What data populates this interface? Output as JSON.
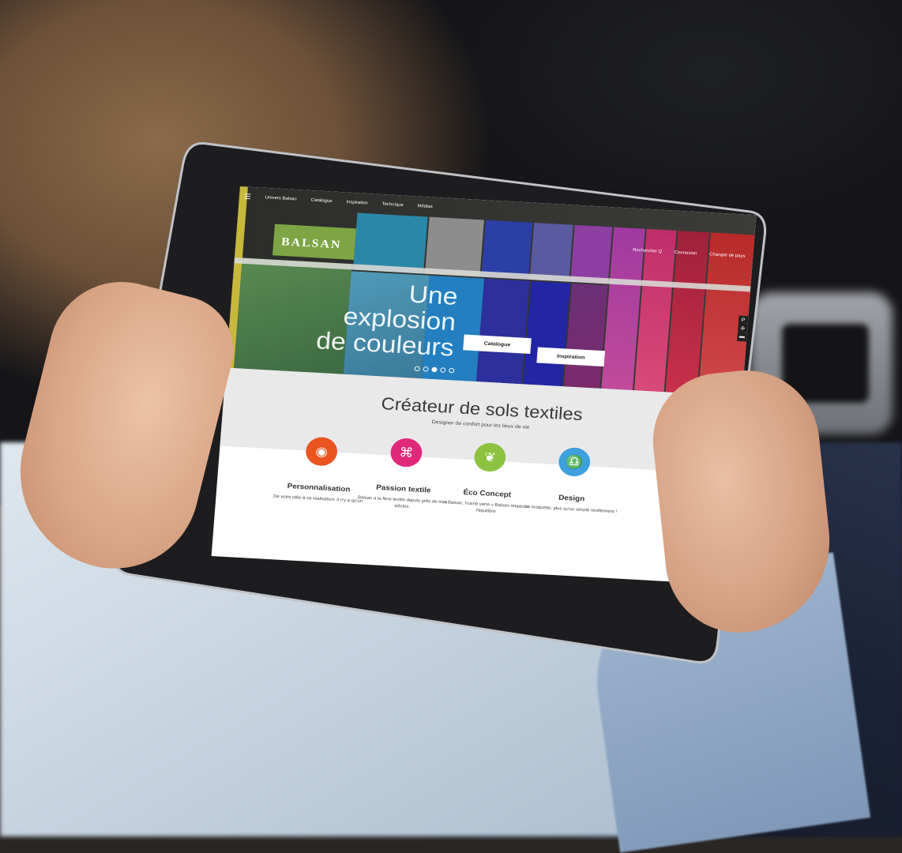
{
  "site": {
    "nav": {
      "menu_icon": "hamburger-icon",
      "items": [
        "Univers Balsan",
        "Catalogue",
        "Inspiration",
        "Technique",
        "Médias"
      ],
      "right": [
        "Rechercher Q",
        "Connexion",
        "Changer de pays"
      ]
    },
    "logo_text": "BALSAN",
    "hero": {
      "headline_line1": "Une explosion",
      "headline_line2": "de couleurs",
      "button_catalogue": "Catalogue",
      "button_inspiration": "Inspiration",
      "slides": 5,
      "active_slide": 3
    },
    "section": {
      "title": "Créateur de sols textiles",
      "subtitle": "Designer de confort pour les lieux de vie"
    },
    "features": [
      {
        "title": "Personnalisation",
        "desc": "De votre idée à sa réalisation, il n'y a qu'un",
        "color": "#e9541f",
        "icon": "disc-icon"
      },
      {
        "title": "Passion textile",
        "desc": "Balsan a la fibre textile depuis près de trois siècles.",
        "color": "#e0287a",
        "icon": "knot-icon"
      },
      {
        "title": "Éco Concept",
        "desc": "« Balsan, l'usine verte » Balsan respecte l'équilibre",
        "color": "#8cc23f",
        "icon": "leaf-icon"
      },
      {
        "title": "Design",
        "desc": "La moquette, plus qu'un simple revêtement !",
        "color": "#3ea0dd",
        "icon": "cloche-icon"
      }
    ]
  }
}
